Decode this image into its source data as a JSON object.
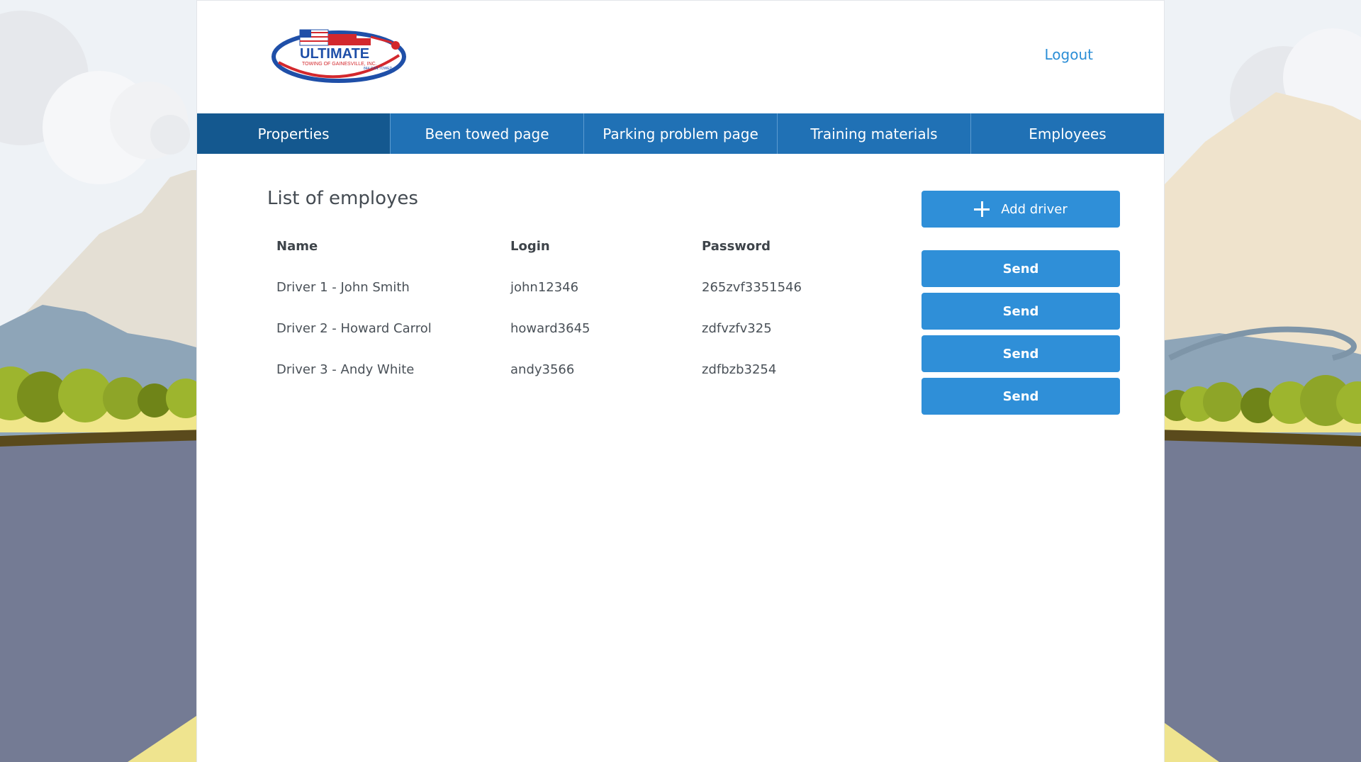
{
  "logo": {
    "brand": "ULTIMATE",
    "sub": "TOWING OF GAINESVILLE, INC.",
    "phone": "844.CAN.TOWED"
  },
  "header": {
    "logout_label": "Logout"
  },
  "nav": {
    "items": [
      {
        "label": "Properties"
      },
      {
        "label": "Been towed page"
      },
      {
        "label": "Parking problem page"
      },
      {
        "label": "Training materials"
      },
      {
        "label": "Employees"
      }
    ]
  },
  "main": {
    "title": "List of employes",
    "add_label": "Add driver",
    "columns": [
      "Name",
      "Login",
      "Password"
    ],
    "rows": [
      {
        "name": "Driver 1 - John Smith",
        "login": "john12346",
        "password": "265zvf3351546",
        "action": "Send"
      },
      {
        "name": "Driver 2 - Howard Carrol",
        "login": "howard3645",
        "password": "zdfvzfv325",
        "action": "Send"
      },
      {
        "name": "Driver 3 - Andy White",
        "login": "andy3566",
        "password": "zdfbzb3254",
        "action": "Send"
      }
    ],
    "header_action": "Send"
  },
  "colors": {
    "nav": "#2071b5",
    "nav_active": "#14588f",
    "button": "#2f8fd8",
    "link": "#2b8ed6"
  }
}
